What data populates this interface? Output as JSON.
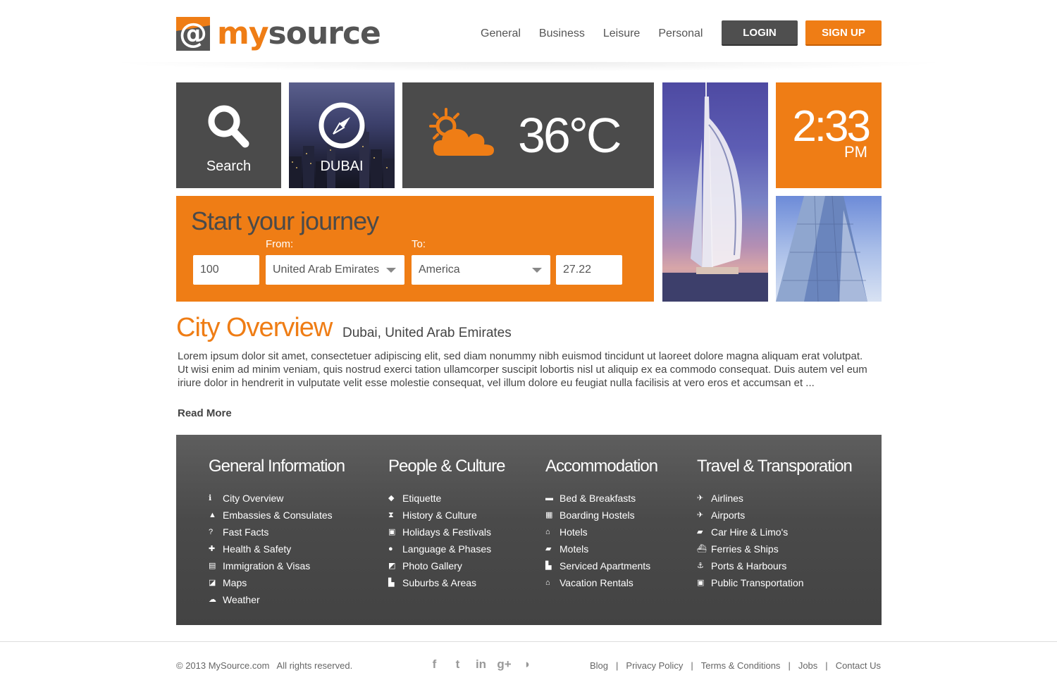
{
  "header": {
    "logo_my": "my",
    "logo_source": "source",
    "nav": [
      "General",
      "Business",
      "Leisure",
      "Personal"
    ],
    "login_label": "LOGIN",
    "signup_label": "SIGN UP"
  },
  "tiles": {
    "search_label": "Search",
    "city_label": "DUBAI",
    "temperature": "36°C",
    "time": "2:33",
    "ampm": "PM"
  },
  "journey": {
    "title": "Start your journey",
    "from_label": "From:",
    "to_label": "To:",
    "amount": "100",
    "from_value": "United Arab Emirates",
    "to_value": "America",
    "result": "27.22"
  },
  "overview": {
    "title": "City Overview",
    "subtitle": "Dubai, United Arab Emirates",
    "text": "Lorem ipsum dolor sit amet, consectetuer adipiscing elit, sed diam nonummy nibh euismod tincidunt ut laoreet dolore magna aliquam erat volutpat. Ut wisi enim ad minim veniam, quis nostrud exerci tation ullamcorper suscipit lobortis nisl ut aliquip ex ea commodo consequat. Duis autem vel eum iriure dolor in hendrerit in vulputate velit esse molestie consequat, vel illum dolore eu feugiat nulla facilisis at vero eros et accumsan et ...",
    "read_more": "Read More"
  },
  "columns": [
    {
      "title": "General Information",
      "items": [
        {
          "label": "City Overview",
          "icon": "info-icon"
        },
        {
          "label": "Embassies & Consulates",
          "icon": "building-icon"
        },
        {
          "label": "Fast Facts",
          "icon": "question-icon"
        },
        {
          "label": "Health & Safety",
          "icon": "plus-icon"
        },
        {
          "label": "Immigration & Visas",
          "icon": "document-icon"
        },
        {
          "label": "Maps",
          "icon": "map-icon"
        },
        {
          "label": "Weather",
          "icon": "cloud-icon"
        }
      ]
    },
    {
      "title": "People & Culture",
      "items": [
        {
          "label": "Etiquette",
          "icon": "tag-icon"
        },
        {
          "label": "History & Culture",
          "icon": "hourglass-icon"
        },
        {
          "label": "Holidays & Festivals",
          "icon": "gift-icon"
        },
        {
          "label": "Language & Phases",
          "icon": "speech-icon"
        },
        {
          "label": "Photo Gallery",
          "icon": "photo-icon"
        },
        {
          "label": "Suburbs & Areas",
          "icon": "city-icon"
        }
      ]
    },
    {
      "title": "Accommodation",
      "items": [
        {
          "label": "Bed & Breakfasts",
          "icon": "bed-icon"
        },
        {
          "label": "Boarding Hostels",
          "icon": "hostel-icon"
        },
        {
          "label": "Hotels",
          "icon": "hotel-icon"
        },
        {
          "label": "Motels",
          "icon": "car-icon"
        },
        {
          "label": "Serviced Apartments",
          "icon": "apartment-icon"
        },
        {
          "label": "Vacation Rentals",
          "icon": "house-icon"
        }
      ]
    },
    {
      "title": "Travel & Transporation",
      "items": [
        {
          "label": "Airlines",
          "icon": "plane-icon"
        },
        {
          "label": "Airports",
          "icon": "takeoff-icon"
        },
        {
          "label": "Car Hire & Limo's",
          "icon": "limo-icon"
        },
        {
          "label": "Ferries & Ships",
          "icon": "ship-icon"
        },
        {
          "label": "Ports & Harbours",
          "icon": "anchor-icon"
        },
        {
          "label": "Public Transportation",
          "icon": "bus-icon"
        }
      ]
    }
  ],
  "footer": {
    "copyright": "© 2013 MySource.com   All rights reserved.",
    "social": [
      "facebook-icon",
      "twitter-icon",
      "linkedin-icon",
      "googleplus-icon",
      "rss-icon"
    ],
    "links": [
      "Blog",
      "Privacy Policy",
      "Terms & Conditions",
      "Jobs",
      "Contact Us"
    ]
  },
  "colors": {
    "accent": "#ef7d15",
    "dark": "#4b4b4b"
  }
}
